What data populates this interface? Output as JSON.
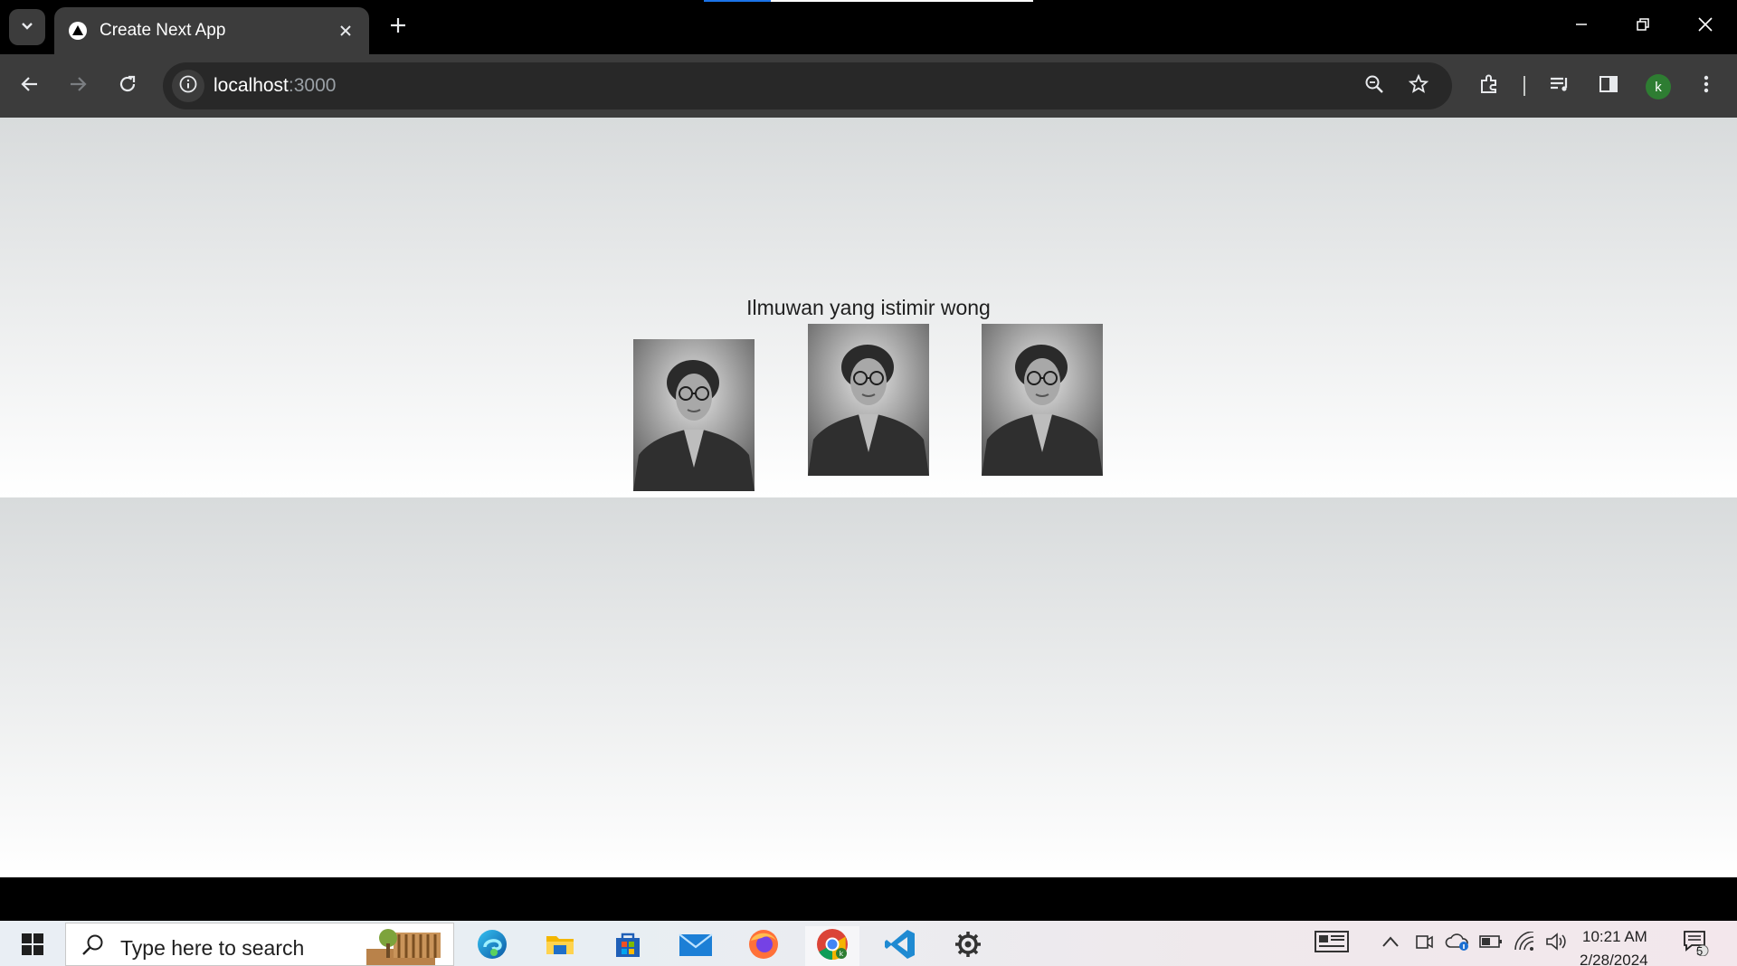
{
  "browser": {
    "tab_title": "Create Next App",
    "url_host": "localhost",
    "url_port": ":3000",
    "icons": [
      "tab-search-icon",
      "next-favicon-icon",
      "close-icon",
      "plus-icon",
      "minimize-icon",
      "restore-icon",
      "close-window-icon",
      "back-icon",
      "forward-icon",
      "reload-icon",
      "info-icon",
      "zoom-icon",
      "star-icon",
      "extensions-icon",
      "media-icon",
      "side-panel-icon",
      "menu-icon"
    ],
    "profile_initial": "k"
  },
  "page": {
    "heading": "Ilmuwan yang istimir wong",
    "images": [
      {
        "subject": "portrait"
      },
      {
        "subject": "portrait"
      },
      {
        "subject": "portrait"
      }
    ],
    "colors": {
      "gradient_top": "#d8dbdc",
      "gradient_bottom": "#ffffff"
    }
  },
  "taskbar": {
    "search_placeholder": "Type here to search",
    "apps": [
      "edge-icon",
      "file-explorer-icon",
      "store-icon",
      "mail-icon",
      "firefox-icon",
      "chrome-icon",
      "vscode-icon",
      "settings-icon"
    ],
    "tray_icons": [
      "news-icon",
      "chevron-up-icon",
      "meet-icon",
      "onedrive-icon",
      "battery-icon",
      "wifi-icon",
      "volume-icon"
    ],
    "time": "10:21 AM",
    "date": "2/28/2024",
    "notification_count": "5"
  }
}
